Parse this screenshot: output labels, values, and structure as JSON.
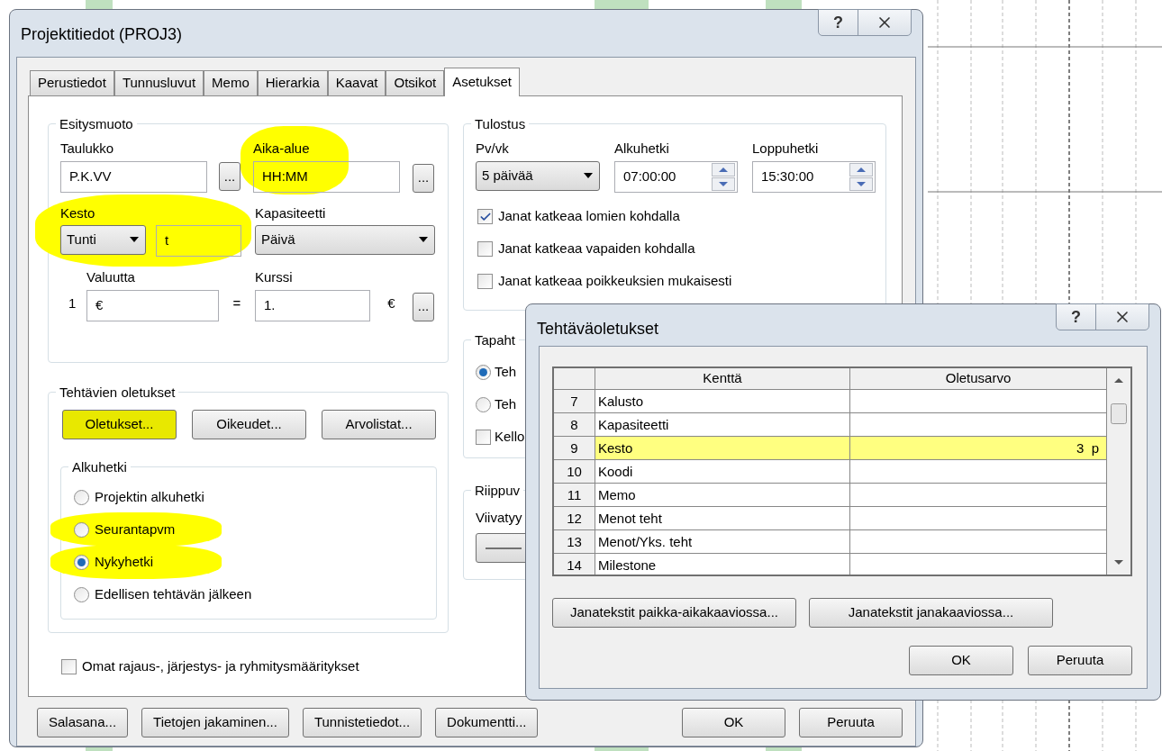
{
  "main_dialog": {
    "title": "Projektitiedot (PROJ3)",
    "help_button": "?",
    "tabs": [
      {
        "label": "Perustiedot",
        "selected": false
      },
      {
        "label": "Tunnusluvut",
        "selected": false
      },
      {
        "label": "Memo",
        "selected": false
      },
      {
        "label": "Hierarkia",
        "selected": false
      },
      {
        "label": "Kaavat",
        "selected": false
      },
      {
        "label": "Otsikot",
        "selected": false
      },
      {
        "label": "Asetukset",
        "selected": true
      }
    ],
    "presentation": {
      "title": "Esitysmuoto",
      "table": {
        "label": "Taulukko",
        "value": "P.K.VV",
        "browse": "..."
      },
      "time_range": {
        "label": "Aika-alue",
        "value": "HH:MM",
        "browse": "...",
        "highlighted": true
      },
      "duration": {
        "label": "Kesto",
        "unit": "Tunti",
        "suffix": "t",
        "highlighted": true
      },
      "capacity": {
        "label": "Kapasiteetti",
        "value": "Päivä"
      },
      "currency": {
        "label": "Valuutta",
        "prefix": "1",
        "value": "€"
      },
      "rate": {
        "label": "Kurssi",
        "equals": "=",
        "value": "1.",
        "unit": "€",
        "browse": "..."
      }
    },
    "print": {
      "title": "Tulostus",
      "days": {
        "label": "Pv/vk",
        "value": "5 päivää"
      },
      "start": {
        "label": "Alkuhetki",
        "value": "07:00:00"
      },
      "end": {
        "label": "Loppuhetki",
        "value": "15:30:00"
      },
      "checkboxes": [
        {
          "label": "Janat katkeaa lomien kohdalla",
          "checked": true
        },
        {
          "label": "Janat katkeaa vapaiden kohdalla",
          "checked": false
        },
        {
          "label": "Janat katkeaa poikkeuksien mukaisesti",
          "checked": false
        }
      ]
    },
    "events": {
      "title": "Tapaht",
      "options": [
        {
          "kind": "radio",
          "label": "Teh",
          "selected": true
        },
        {
          "kind": "radio",
          "label": "Teh",
          "selected": false
        },
        {
          "kind": "checkbox",
          "label": "Kello",
          "checked": false
        }
      ]
    },
    "dependencies": {
      "title": "Riippuv",
      "line_style_label": "Viivatyy"
    },
    "task_defaults": {
      "title": "Tehtävien oletukset",
      "buttons": [
        {
          "label": "Oletukset...",
          "highlighted": true
        },
        {
          "label": "Oikeudet...",
          "highlighted": false
        },
        {
          "label": "Arvolistat...",
          "highlighted": false
        }
      ],
      "start_group": {
        "title": "Alkuhetki",
        "options": [
          {
            "label": "Projektin alkuhetki",
            "selected": false,
            "highlighted": false
          },
          {
            "label": "Seurantapvm",
            "selected": false,
            "highlighted": true
          },
          {
            "label": "Nykyhetki",
            "selected": true,
            "highlighted": true
          },
          {
            "label": "Edellisen tehtävän jälkeen",
            "selected": false,
            "highlighted": false
          }
        ]
      }
    },
    "own_definitions": {
      "label": "Omat rajaus-, järjestys- ja ryhmitysmääritykset",
      "checked": false
    },
    "footer_buttons": [
      "Salasana...",
      "Tietojen jakaminen...",
      "Tunnistetiedot...",
      "Dokumentti..."
    ],
    "ok": "OK",
    "cancel": "Peruuta"
  },
  "defaults_dialog": {
    "title": "Tehtäväoletukset",
    "help_button": "?",
    "columns": [
      "Kenttä",
      "Oletusarvo"
    ],
    "rows": [
      {
        "number": "7",
        "field": "Kalusto",
        "value": "",
        "selected": false
      },
      {
        "number": "8",
        "field": "Kapasiteetti",
        "value": "",
        "selected": false
      },
      {
        "number": "9",
        "field": "Kesto",
        "value": "3  p",
        "selected": true
      },
      {
        "number": "10",
        "field": "Koodi",
        "value": "",
        "selected": false
      },
      {
        "number": "11",
        "field": "Memo",
        "value": "",
        "selected": false
      },
      {
        "number": "12",
        "field": "Menot teht",
        "value": "",
        "selected": false
      },
      {
        "number": "13",
        "field": "Menot/Yks. teht",
        "value": "",
        "selected": false
      },
      {
        "number": "14",
        "field": "Milestone",
        "value": "",
        "selected": false
      }
    ],
    "buttons": [
      "Janatekstit paikka-aikakaaviossa...",
      "Janatekstit janakaaviossa..."
    ],
    "ok": "OK",
    "cancel": "Peruuta"
  }
}
